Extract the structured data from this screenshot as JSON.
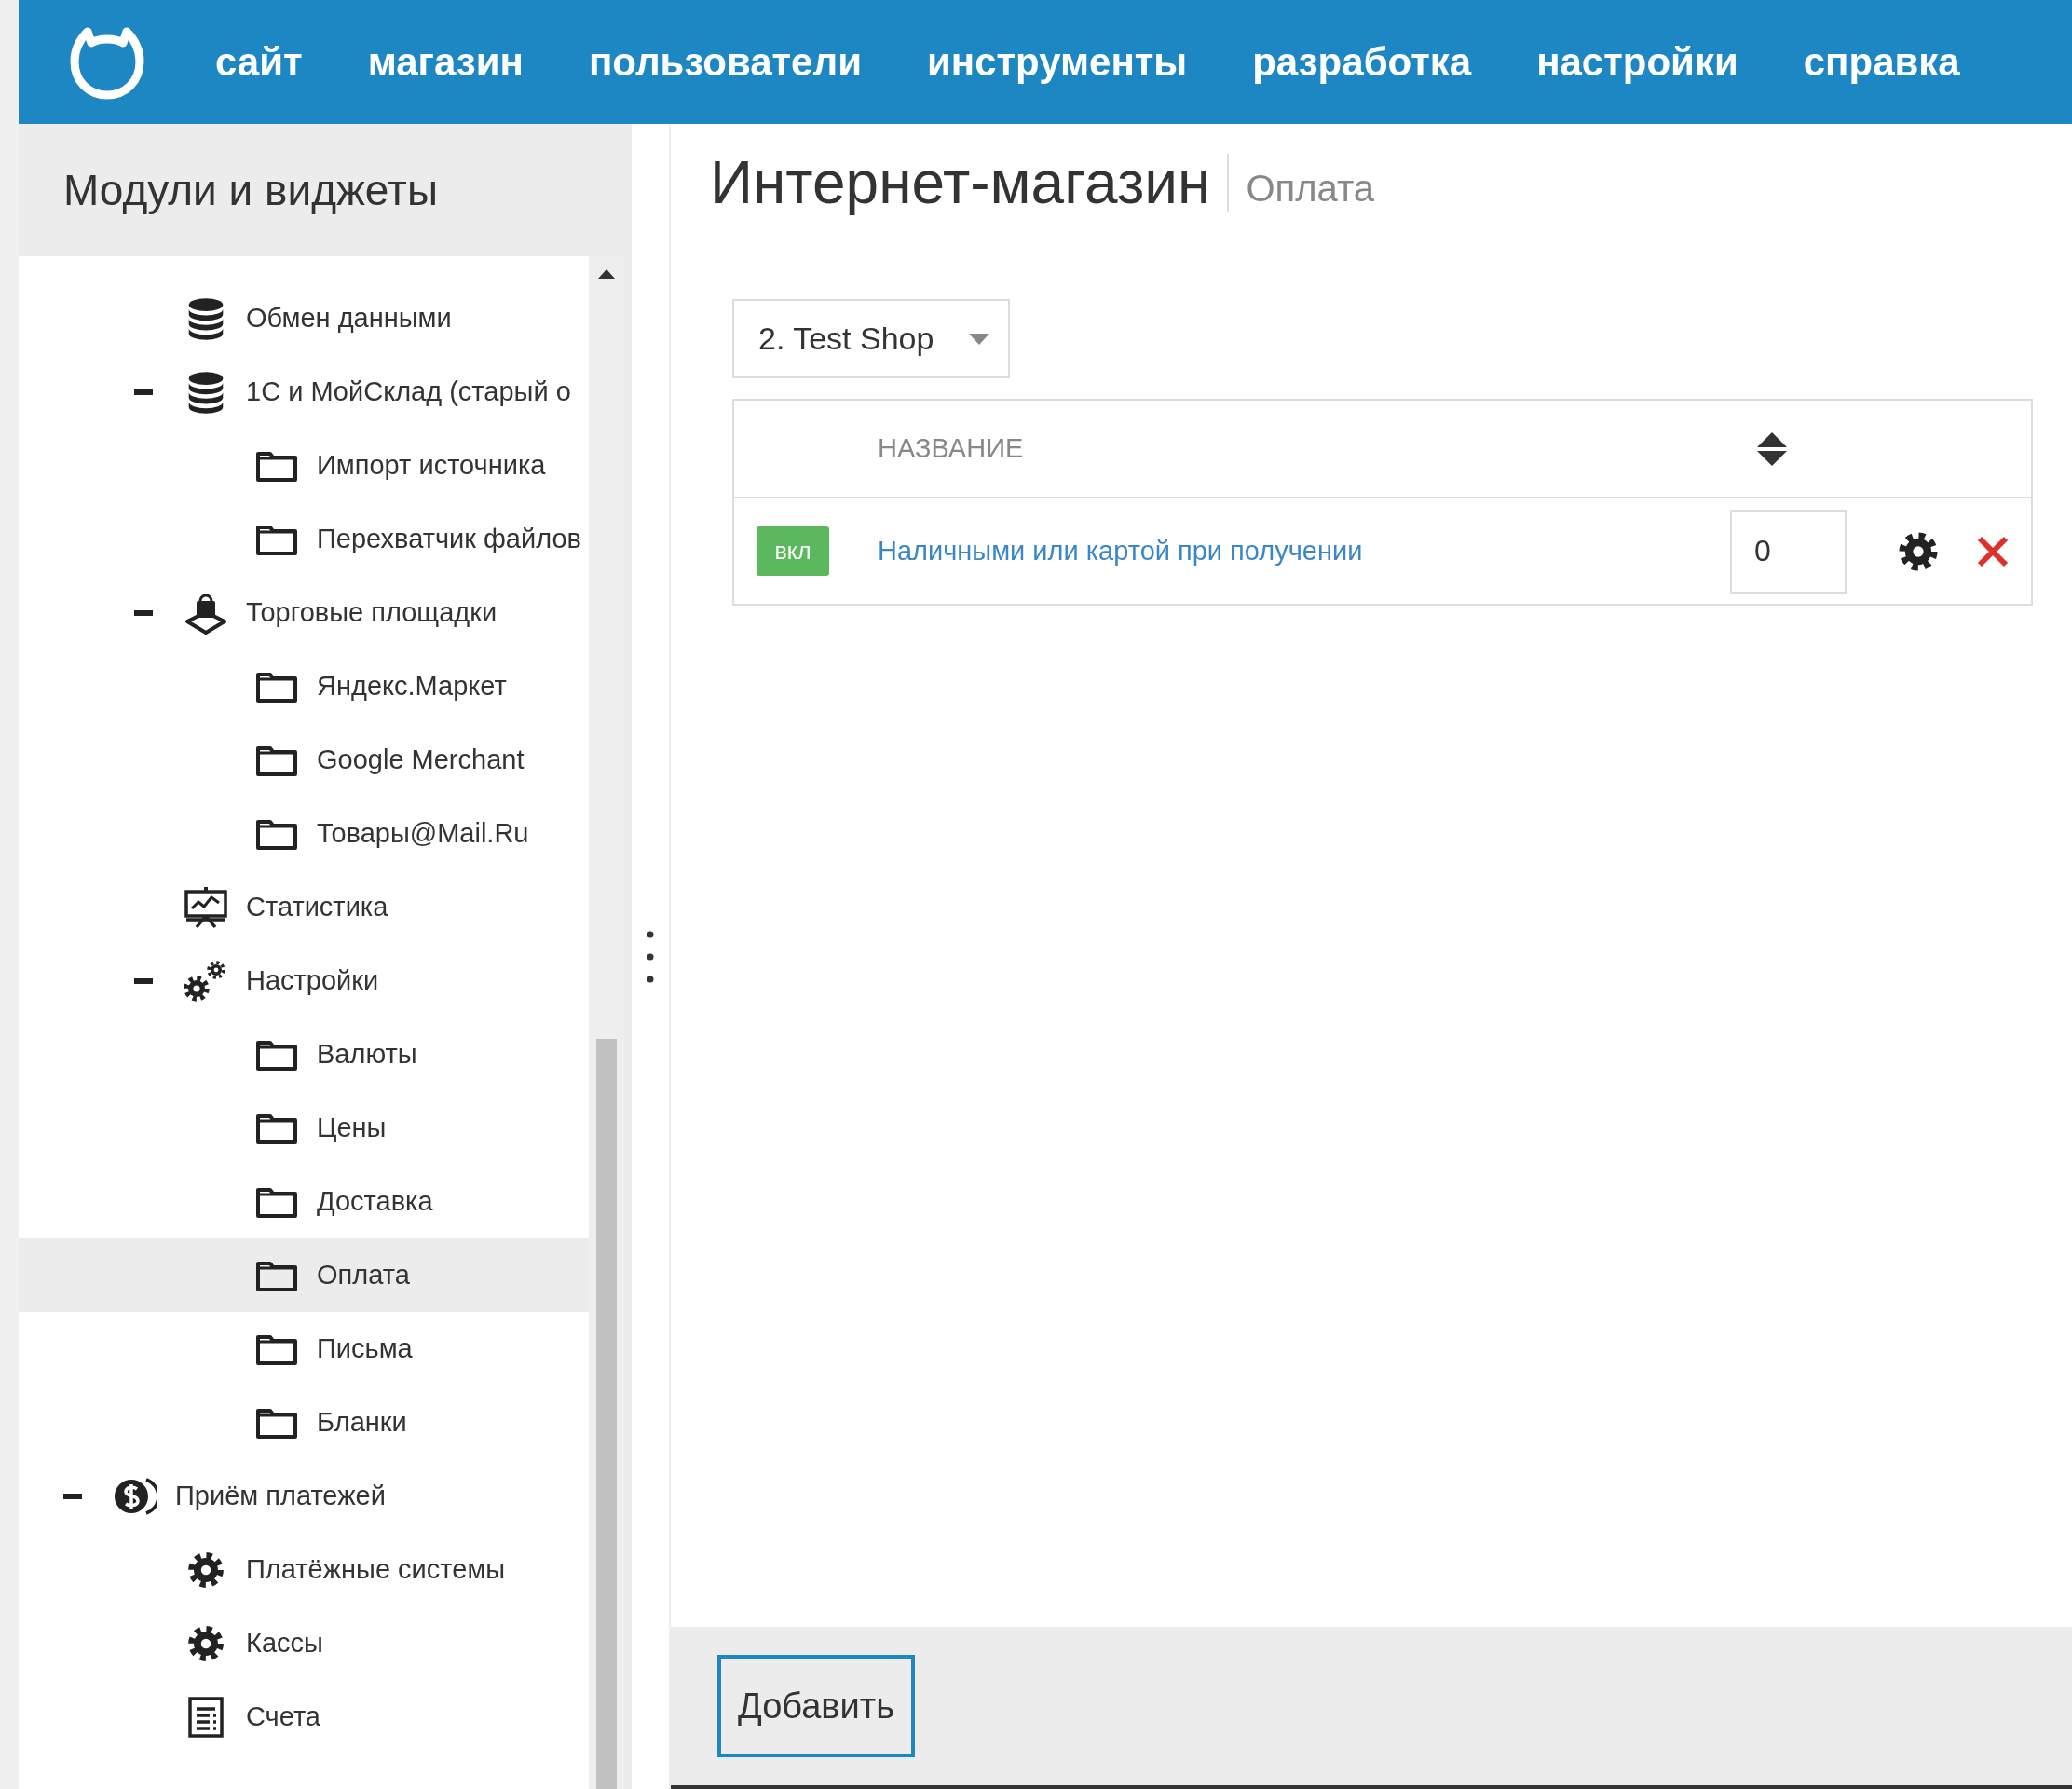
{
  "top_nav": {
    "items": [
      "сайт",
      "магазин",
      "пользователи",
      "инструменты",
      "разработка",
      "настройки",
      "справка"
    ]
  },
  "sidebar": {
    "title": "Модули и виджеты",
    "items": [
      {
        "children": [
          {
            "label": "Обмен данными",
            "kind": "database",
            "selected": false
          },
          {
            "label": "1С и МойСклад (старый о",
            "kind": "database",
            "expanded": true,
            "selected": false,
            "children": [
              {
                "label": "Импорт источника",
                "kind": "folder",
                "selected": false
              },
              {
                "label": "Перехватчик файлов",
                "kind": "folder",
                "selected": false
              }
            ]
          },
          {
            "label": "Торговые площадки",
            "kind": "marketplace",
            "expanded": true,
            "selected": false,
            "children": [
              {
                "label": "Яндекс.Маркет",
                "kind": "folder",
                "selected": false
              },
              {
                "label": "Google Merchant",
                "kind": "folder",
                "selected": false
              },
              {
                "label": "Товары@Mail.Ru",
                "kind": "folder",
                "selected": false
              }
            ]
          },
          {
            "label": "Статистика",
            "kind": "chart",
            "selected": false
          },
          {
            "label": "Настройки",
            "kind": "gears",
            "expanded": true,
            "selected": false,
            "children": [
              {
                "label": "Валюты",
                "kind": "folder",
                "selected": false
              },
              {
                "label": "Цены",
                "kind": "folder",
                "selected": false
              },
              {
                "label": "Доставка",
                "kind": "folder",
                "selected": false
              },
              {
                "label": "Оплата",
                "kind": "folder",
                "selected": true
              },
              {
                "label": "Письма",
                "kind": "folder",
                "selected": false
              },
              {
                "label": "Бланки",
                "kind": "folder",
                "selected": false
              }
            ]
          }
        ]
      },
      {
        "label": "Приём платежей",
        "kind": "coin",
        "expanded": true,
        "selected": false,
        "children": [
          {
            "label": "Платёжные системы",
            "kind": "gear",
            "selected": false
          },
          {
            "label": "Кассы",
            "kind": "gear",
            "selected": false
          },
          {
            "label": "Счета",
            "kind": "invoice",
            "selected": false
          }
        ]
      }
    ]
  },
  "page": {
    "title": "Интернет-магазин",
    "subtitle": "Оплата"
  },
  "shop_select": {
    "value": "2. Test Shop"
  },
  "table": {
    "columns": [
      {
        "label": "НАЗВАНИЕ"
      }
    ],
    "rows": [
      {
        "enabled": true,
        "status": "вкл",
        "name": "Наличными или картой при получении",
        "sort": "0"
      }
    ]
  },
  "footer": {
    "buttons": [
      "Добавить"
    ]
  }
}
